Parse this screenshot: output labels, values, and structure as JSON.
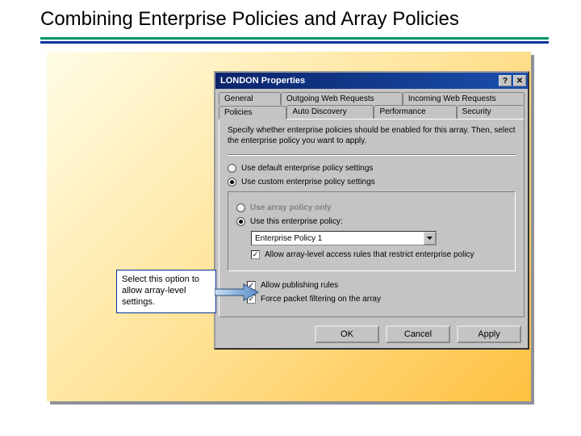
{
  "slide": {
    "title": "Combining Enterprise Policies and Array Policies",
    "callout": "Select this option to allow array-level settings."
  },
  "dialog": {
    "title": "LONDON Properties",
    "help": "?",
    "close": "✕",
    "tabs_row1": [
      "General",
      "Outgoing Web Requests",
      "Incoming Web Requests"
    ],
    "tabs_row2": [
      "Policies",
      "Auto Discovery",
      "Performance",
      "Security"
    ],
    "desc": "Specify whether enterprise policies should be enabled for this array. Then, select the enterprise policy you want to apply.",
    "opt_default": "Use default enterprise policy settings",
    "opt_custom": "Use custom enterprise policy settings",
    "sub_array_only": "Use array policy only",
    "sub_use_policy": "Use this enterprise policy:",
    "policy_value": "Enterprise Policy 1",
    "chk_allow_array": "Allow array-level access rules that restrict enterprise policy",
    "chk_allow_publishing": "Allow publishing rules",
    "chk_force_filter": "Force packet filtering on the array",
    "btn_ok": "OK",
    "btn_cancel": "Cancel",
    "btn_apply": "Apply"
  }
}
